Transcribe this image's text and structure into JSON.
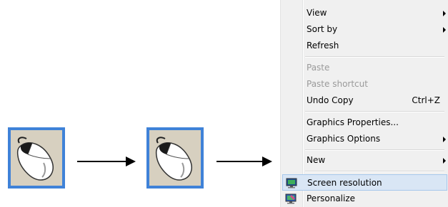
{
  "context_menu": {
    "items": [
      {
        "label": "View",
        "submenu": true
      },
      {
        "label": "Sort by",
        "submenu": true
      },
      {
        "label": "Refresh"
      },
      {
        "label": "Paste",
        "disabled": true
      },
      {
        "label": "Paste shortcut",
        "disabled": true
      },
      {
        "label": "Undo Copy",
        "shortcut": "Ctrl+Z"
      },
      {
        "label": "Graphics Properties..."
      },
      {
        "label": "Graphics Options",
        "submenu": true
      },
      {
        "label": "New",
        "submenu": true
      },
      {
        "label": "Screen resolution",
        "highlighted": true,
        "icon": "screen-resolution-icon"
      },
      {
        "label": "Personalize",
        "icon": "personalize-icon"
      }
    ]
  },
  "colors": {
    "mouse_frame": "#3f82d8",
    "menu_background": "#f0f0f0",
    "highlight_background": "#d9e6f5",
    "highlight_border": "#a6c7ec",
    "disabled_text": "#9a9a9a"
  }
}
